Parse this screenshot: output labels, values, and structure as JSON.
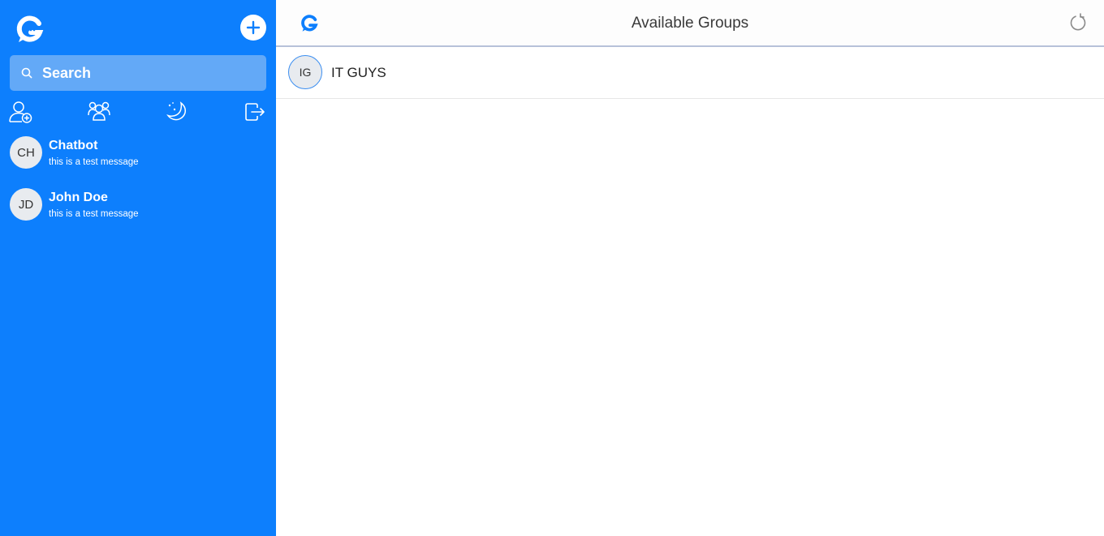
{
  "colors": {
    "sidebar_bg": "#0d7ffd",
    "search_bg": "#63a9f7",
    "accent": "#0d7ffd"
  },
  "sidebar": {
    "logo": "app-logo",
    "new_button_icon": "plus-icon",
    "search": {
      "label": "Search",
      "icon": "search-icon"
    },
    "actions": [
      {
        "icon": "add-user-icon"
      },
      {
        "icon": "users-group-icon"
      },
      {
        "icon": "moon-stars-icon"
      },
      {
        "icon": "logout-icon"
      }
    ],
    "chats": [
      {
        "initials": "CH",
        "name": "Chatbot",
        "preview": "this is a test message"
      },
      {
        "initials": "JD",
        "name": "John Doe",
        "preview": "this is a test message"
      }
    ]
  },
  "main": {
    "header": {
      "title": "Available Groups",
      "logo": "app-logo",
      "refresh_icon": "refresh-icon"
    },
    "groups": [
      {
        "initials": "IG",
        "name": "IT GUYS"
      }
    ]
  }
}
